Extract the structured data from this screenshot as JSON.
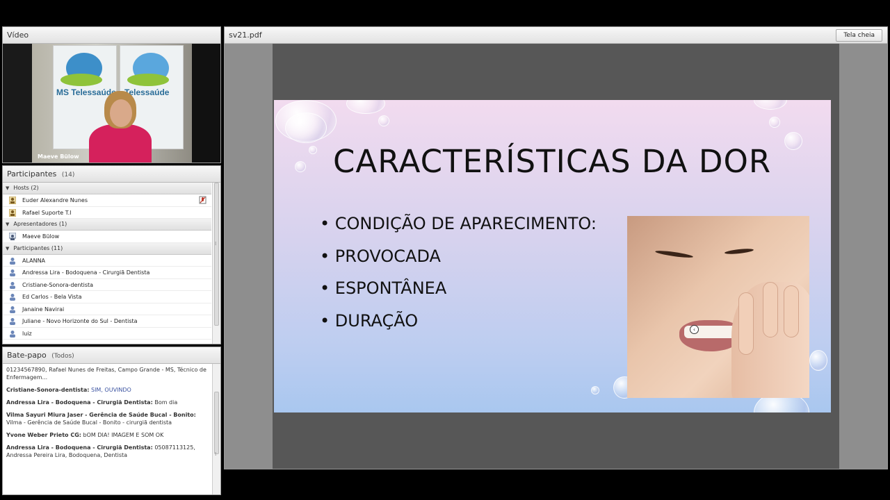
{
  "video_pod": {
    "title": "Vídeo",
    "presenter_name": "Maeve Bülow",
    "banner_left": "MS Telessaúde",
    "banner_right": "Telessaúde"
  },
  "participants_pod": {
    "title": "Participantes",
    "count": "(14)",
    "groups": [
      {
        "label": "Hosts (2)",
        "members": [
          "Euder Alexandre Nunes",
          "Rafael Suporte T.I"
        ]
      },
      {
        "label": "Apresentadores (1)",
        "members": [
          "Maeve Bülow"
        ]
      },
      {
        "label": "Participantes (11)",
        "members": [
          "ALANNA",
          "Andressa Lira - Bodoquena - Cirurgiã Dentista",
          "Cristiane-Sonora-dentista",
          "Ed Carlos - Bela Vista",
          "Janaine Navirai",
          "Juliane - Novo Horizonte do Sul - Dentista",
          "luiz"
        ]
      }
    ]
  },
  "chat_pod": {
    "title": "Bate-papo",
    "scope": "(Todos)",
    "messages": [
      {
        "sender": "",
        "text": "01234567890, Rafael Nunes de Freitas, Campo Grande - MS, Técnico de Enfermagem..."
      },
      {
        "sender": "Cristiane-Sonora-dentista:",
        "text": "SIM, OUVINDO"
      },
      {
        "sender": "Andressa Lira - Bodoquena - Cirurgiã Dentista:",
        "text": "Bom dia"
      },
      {
        "sender": "Vilma Sayuri Miura Jaser - Gerência de Saúde Bucal - Bonito:",
        "text": "Vilma - Gerência de Saúde Bucal - Bonito - cirurgiã dentista"
      },
      {
        "sender": "Yvone Weber Prieto CG:",
        "text": "bOM DIA! IMAGEM E SOM OK"
      },
      {
        "sender": "Andressa Lira - Bodoquena - Cirurgiã Dentista:",
        "text": "05087113125, Andressa Pereira Lira, Bodoquena, Dentista"
      }
    ]
  },
  "share_pod": {
    "filename": "sv21.pdf",
    "fullscreen_label": "Tela cheia",
    "slide": {
      "title": "CARACTERÍSTICAS DA DOR",
      "bullets": [
        "• CONDIÇÃO DE APARECIMENTO:",
        "• PROVOCADA",
        "• ESPONTÂNEA",
        "• DURAÇÃO"
      ]
    }
  }
}
